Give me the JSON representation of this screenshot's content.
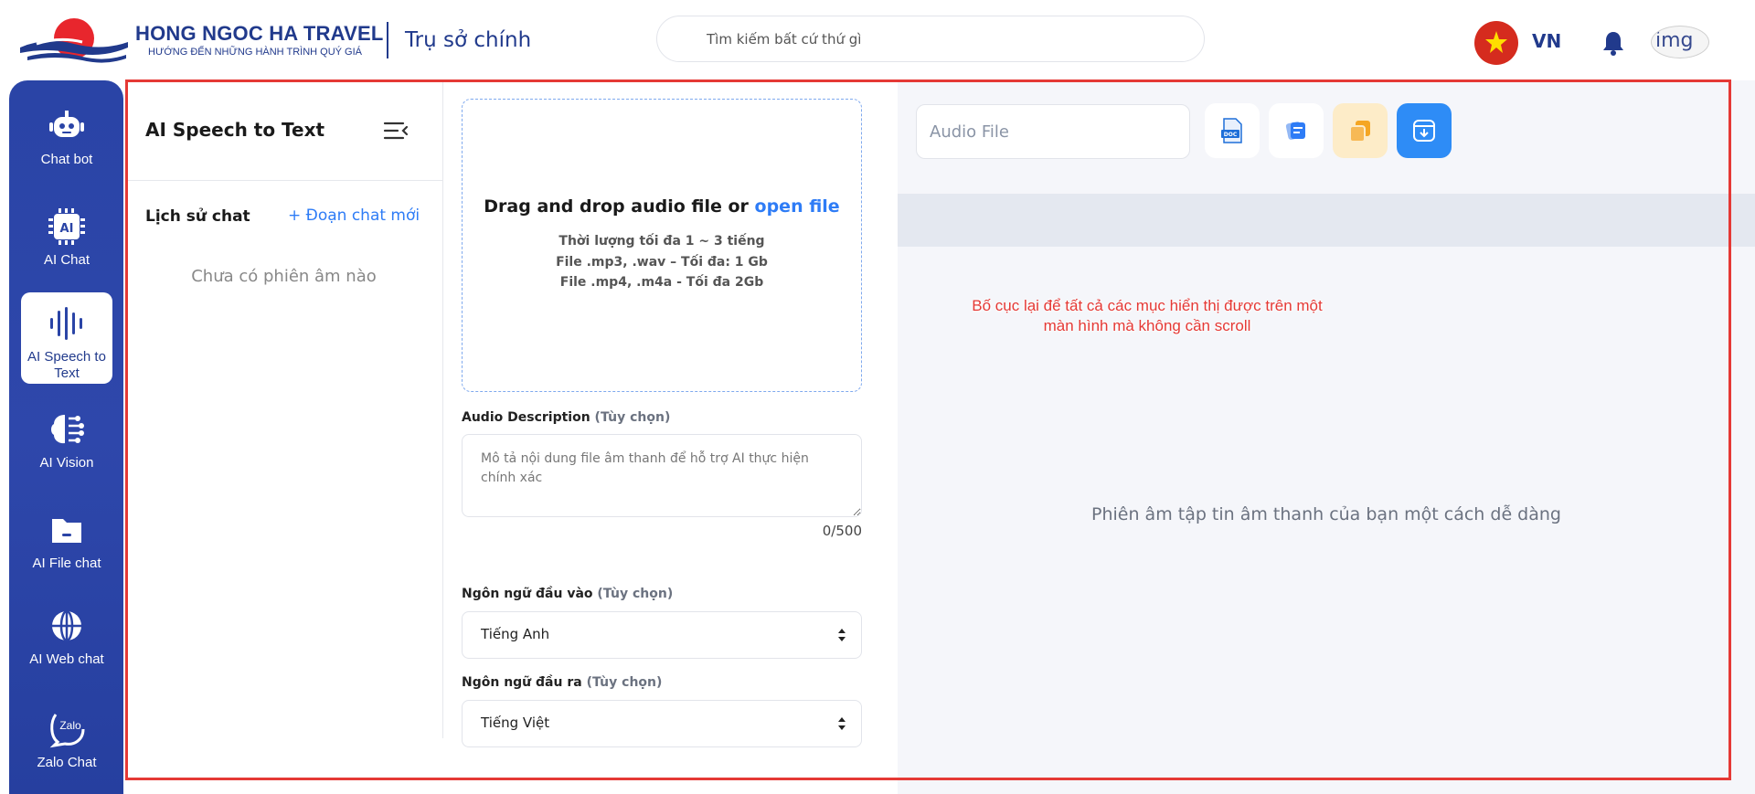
{
  "header": {
    "brand_name": "HONG NGOC HA TRAVEL",
    "brand_tagline": "HƯỚNG ĐẾN NHỮNG HÀNH TRÌNH QUÝ GIÁ",
    "branch": "Trụ sở chính",
    "search_placeholder": "Tìm kiếm bất cứ thứ gì",
    "language": "VN",
    "avatar_alt": "img"
  },
  "sidebar": {
    "items": [
      {
        "label": "Chat bot",
        "icon": "robot-icon"
      },
      {
        "label": "AI Chat",
        "icon": "ai-chip-icon"
      },
      {
        "label": "AI Speech to Text",
        "icon": "soundwave-icon"
      },
      {
        "label": "AI Vision",
        "icon": "brain-icon"
      },
      {
        "label": "AI File chat",
        "icon": "folder-icon"
      },
      {
        "label": "AI Web chat",
        "icon": "globe-icon"
      },
      {
        "label": "Zalo Chat",
        "icon": "zalo-icon"
      }
    ],
    "active_index": 2
  },
  "history": {
    "title": "AI Speech to Text",
    "chat_history_label": "Lịch sử chat",
    "new_chat_label": "+ Đoạn chat mới",
    "empty_text": "Chưa có phiên âm nào"
  },
  "upload": {
    "title_prefix": "Drag and drop audio file or ",
    "title_link": "open file",
    "duration_note": "Thời lượng tối đa 1 ~ 3 tiếng",
    "audio_note": "File .mp3, .wav – Tối đa: 1 Gb",
    "video_note": "File .mp4, .m4a - Tối đa 2Gb"
  },
  "description": {
    "label": "Audio Description",
    "optional": "(Tùy chọn)",
    "placeholder": "Mô tả nội dung file âm thanh để hỗ trợ AI thực hiện chính xác",
    "counter": "0/500"
  },
  "input_language": {
    "label": "Ngôn ngữ đầu vào",
    "optional": "(Tùy chọn)",
    "value": "Tiếng Anh"
  },
  "output_language": {
    "label": "Ngôn ngữ đầu ra",
    "optional": "(Tùy chọn)",
    "value": "Tiếng Việt"
  },
  "result": {
    "audio_file_placeholder": "Audio File",
    "empty_text": "Phiên âm tập tin âm thanh của bạn một cách dễ dàng",
    "tools": [
      {
        "icon": "doc-file-icon",
        "color": "#1e6fd9"
      },
      {
        "icon": "translate-icon",
        "color": "#2e7cf6"
      },
      {
        "icon": "copy-icon",
        "color": "#f5a623"
      },
      {
        "icon": "download-icon",
        "color": "#2e8cf6"
      }
    ]
  },
  "annotation": {
    "note_line1": "Bố cục lại để tất cả các mục hiển thị được trên một",
    "note_line2": "màn hình mà không cần scroll",
    "color": "#e53935"
  }
}
